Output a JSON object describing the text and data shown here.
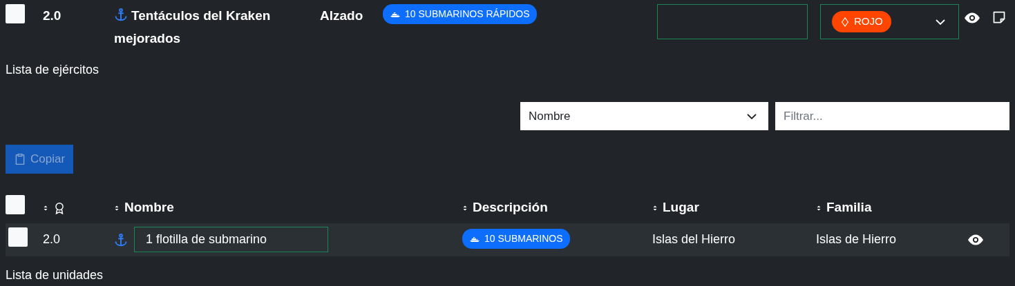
{
  "army": {
    "checked": false,
    "version": "2.0",
    "name": "Tentáculos del Kraken mejorados",
    "status": "Alzado",
    "badge": "10 SUBMARINOS RÁPIDOS",
    "color_select": {
      "label": "ROJO",
      "color": "#ff4500"
    }
  },
  "section_title": "Lista de ejércitos",
  "filter": {
    "field": "Nombre",
    "placeholder": "Filtrar..."
  },
  "copy_button": {
    "label": "Copiar",
    "disabled": true
  },
  "table": {
    "header_checked": false,
    "columns": [
      {
        "kind": "icon"
      },
      {
        "kind": "text",
        "label": "Nombre"
      },
      {
        "kind": "text",
        "label": "Descripción"
      },
      {
        "kind": "text",
        "label": "Lugar"
      },
      {
        "kind": "text",
        "label": "Familia"
      }
    ],
    "rows": [
      {
        "checked": false,
        "version": "2.0",
        "name": "1 flotilla de submarino",
        "description": "10 SUBMARINOS",
        "place": "Islas del Hierro",
        "family": "Islas de Hierro"
      }
    ]
  },
  "footer_title": "Lista de unidades"
}
